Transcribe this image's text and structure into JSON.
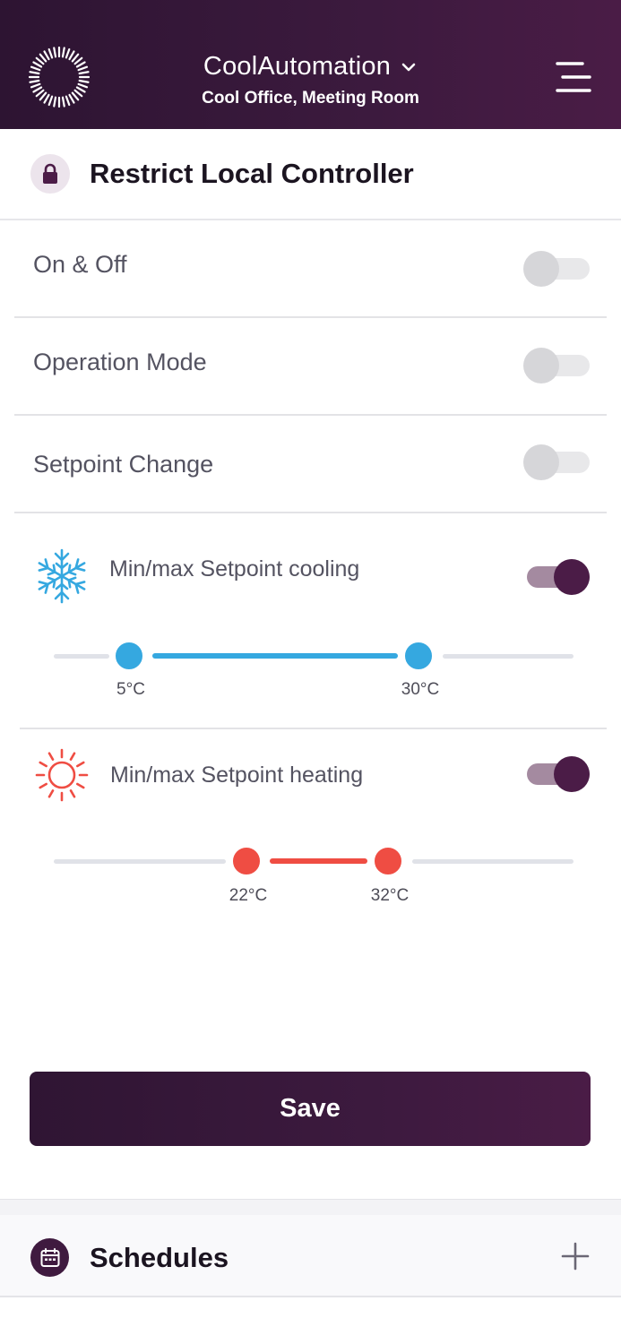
{
  "header": {
    "app_title": "CoolAutomation",
    "subtitle": "Cool Office, Meeting Room",
    "logo_icon": "sunburst-logo-icon",
    "menu_icon": "hamburger-menu-icon"
  },
  "section": {
    "title": "Restrict Local Controller",
    "icon": "lock-icon"
  },
  "rows": [
    {
      "label": "On & Off",
      "enabled": false
    },
    {
      "label": "Operation Mode",
      "enabled": false
    },
    {
      "label": "Setpoint Change",
      "enabled": false
    }
  ],
  "cooling": {
    "label": "Min/max Setpoint cooling",
    "enabled": true,
    "icon": "snowflake-icon",
    "min": "5°C",
    "max": "30°C",
    "color": "#35a8e0"
  },
  "heating": {
    "label": "Min/max Setpoint heating",
    "enabled": true,
    "icon": "sun-icon",
    "min": "22°C",
    "max": "32°C",
    "color": "#ef4d43"
  },
  "save_label": "Save",
  "schedules": {
    "title": "Schedules",
    "icon": "calendar-icon",
    "add_icon": "plus-icon"
  },
  "colors": {
    "brand": "#3c1a3e",
    "toggle_on": "#4b1c47"
  }
}
